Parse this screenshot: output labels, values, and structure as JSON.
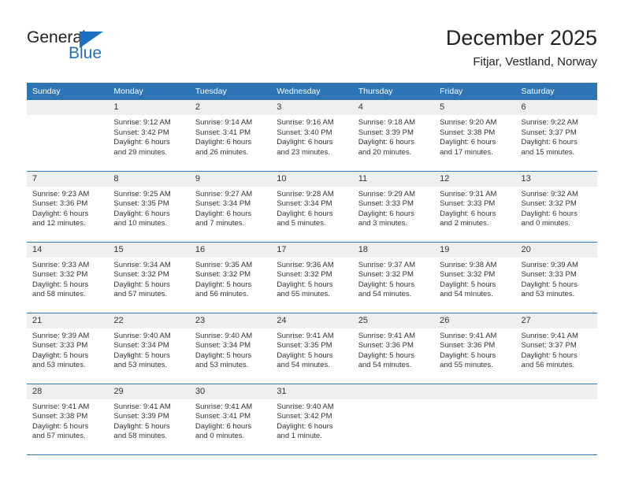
{
  "brand": {
    "word_one": "General",
    "word_two": "Blue",
    "accent_color": "#1f6fc0"
  },
  "header": {
    "title": "December 2025",
    "subtitle": "Fitjar, Vestland, Norway"
  },
  "theme": {
    "header_blue": "#2e75b6",
    "daynum_band": "#efefef",
    "text": "#333333"
  },
  "weekday_headers": [
    "Sunday",
    "Monday",
    "Tuesday",
    "Wednesday",
    "Thursday",
    "Friday",
    "Saturday"
  ],
  "weeks": [
    [
      {
        "day": ""
      },
      {
        "day": "1",
        "sunrise": "Sunrise: 9:12 AM",
        "sunset": "Sunset: 3:42 PM",
        "daylight_1": "Daylight: 6 hours",
        "daylight_2": "and 29 minutes."
      },
      {
        "day": "2",
        "sunrise": "Sunrise: 9:14 AM",
        "sunset": "Sunset: 3:41 PM",
        "daylight_1": "Daylight: 6 hours",
        "daylight_2": "and 26 minutes."
      },
      {
        "day": "3",
        "sunrise": "Sunrise: 9:16 AM",
        "sunset": "Sunset: 3:40 PM",
        "daylight_1": "Daylight: 6 hours",
        "daylight_2": "and 23 minutes."
      },
      {
        "day": "4",
        "sunrise": "Sunrise: 9:18 AM",
        "sunset": "Sunset: 3:39 PM",
        "daylight_1": "Daylight: 6 hours",
        "daylight_2": "and 20 minutes."
      },
      {
        "day": "5",
        "sunrise": "Sunrise: 9:20 AM",
        "sunset": "Sunset: 3:38 PM",
        "daylight_1": "Daylight: 6 hours",
        "daylight_2": "and 17 minutes."
      },
      {
        "day": "6",
        "sunrise": "Sunrise: 9:22 AM",
        "sunset": "Sunset: 3:37 PM",
        "daylight_1": "Daylight: 6 hours",
        "daylight_2": "and 15 minutes."
      }
    ],
    [
      {
        "day": "7",
        "sunrise": "Sunrise: 9:23 AM",
        "sunset": "Sunset: 3:36 PM",
        "daylight_1": "Daylight: 6 hours",
        "daylight_2": "and 12 minutes."
      },
      {
        "day": "8",
        "sunrise": "Sunrise: 9:25 AM",
        "sunset": "Sunset: 3:35 PM",
        "daylight_1": "Daylight: 6 hours",
        "daylight_2": "and 10 minutes."
      },
      {
        "day": "9",
        "sunrise": "Sunrise: 9:27 AM",
        "sunset": "Sunset: 3:34 PM",
        "daylight_1": "Daylight: 6 hours",
        "daylight_2": "and 7 minutes."
      },
      {
        "day": "10",
        "sunrise": "Sunrise: 9:28 AM",
        "sunset": "Sunset: 3:34 PM",
        "daylight_1": "Daylight: 6 hours",
        "daylight_2": "and 5 minutes."
      },
      {
        "day": "11",
        "sunrise": "Sunrise: 9:29 AM",
        "sunset": "Sunset: 3:33 PM",
        "daylight_1": "Daylight: 6 hours",
        "daylight_2": "and 3 minutes."
      },
      {
        "day": "12",
        "sunrise": "Sunrise: 9:31 AM",
        "sunset": "Sunset: 3:33 PM",
        "daylight_1": "Daylight: 6 hours",
        "daylight_2": "and 2 minutes."
      },
      {
        "day": "13",
        "sunrise": "Sunrise: 9:32 AM",
        "sunset": "Sunset: 3:32 PM",
        "daylight_1": "Daylight: 6 hours",
        "daylight_2": "and 0 minutes."
      }
    ],
    [
      {
        "day": "14",
        "sunrise": "Sunrise: 9:33 AM",
        "sunset": "Sunset: 3:32 PM",
        "daylight_1": "Daylight: 5 hours",
        "daylight_2": "and 58 minutes."
      },
      {
        "day": "15",
        "sunrise": "Sunrise: 9:34 AM",
        "sunset": "Sunset: 3:32 PM",
        "daylight_1": "Daylight: 5 hours",
        "daylight_2": "and 57 minutes."
      },
      {
        "day": "16",
        "sunrise": "Sunrise: 9:35 AM",
        "sunset": "Sunset: 3:32 PM",
        "daylight_1": "Daylight: 5 hours",
        "daylight_2": "and 56 minutes."
      },
      {
        "day": "17",
        "sunrise": "Sunrise: 9:36 AM",
        "sunset": "Sunset: 3:32 PM",
        "daylight_1": "Daylight: 5 hours",
        "daylight_2": "and 55 minutes."
      },
      {
        "day": "18",
        "sunrise": "Sunrise: 9:37 AM",
        "sunset": "Sunset: 3:32 PM",
        "daylight_1": "Daylight: 5 hours",
        "daylight_2": "and 54 minutes."
      },
      {
        "day": "19",
        "sunrise": "Sunrise: 9:38 AM",
        "sunset": "Sunset: 3:32 PM",
        "daylight_1": "Daylight: 5 hours",
        "daylight_2": "and 54 minutes."
      },
      {
        "day": "20",
        "sunrise": "Sunrise: 9:39 AM",
        "sunset": "Sunset: 3:33 PM",
        "daylight_1": "Daylight: 5 hours",
        "daylight_2": "and 53 minutes."
      }
    ],
    [
      {
        "day": "21",
        "sunrise": "Sunrise: 9:39 AM",
        "sunset": "Sunset: 3:33 PM",
        "daylight_1": "Daylight: 5 hours",
        "daylight_2": "and 53 minutes."
      },
      {
        "day": "22",
        "sunrise": "Sunrise: 9:40 AM",
        "sunset": "Sunset: 3:34 PM",
        "daylight_1": "Daylight: 5 hours",
        "daylight_2": "and 53 minutes."
      },
      {
        "day": "23",
        "sunrise": "Sunrise: 9:40 AM",
        "sunset": "Sunset: 3:34 PM",
        "daylight_1": "Daylight: 5 hours",
        "daylight_2": "and 53 minutes."
      },
      {
        "day": "24",
        "sunrise": "Sunrise: 9:41 AM",
        "sunset": "Sunset: 3:35 PM",
        "daylight_1": "Daylight: 5 hours",
        "daylight_2": "and 54 minutes."
      },
      {
        "day": "25",
        "sunrise": "Sunrise: 9:41 AM",
        "sunset": "Sunset: 3:36 PM",
        "daylight_1": "Daylight: 5 hours",
        "daylight_2": "and 54 minutes."
      },
      {
        "day": "26",
        "sunrise": "Sunrise: 9:41 AM",
        "sunset": "Sunset: 3:36 PM",
        "daylight_1": "Daylight: 5 hours",
        "daylight_2": "and 55 minutes."
      },
      {
        "day": "27",
        "sunrise": "Sunrise: 9:41 AM",
        "sunset": "Sunset: 3:37 PM",
        "daylight_1": "Daylight: 5 hours",
        "daylight_2": "and 56 minutes."
      }
    ],
    [
      {
        "day": "28",
        "sunrise": "Sunrise: 9:41 AM",
        "sunset": "Sunset: 3:38 PM",
        "daylight_1": "Daylight: 5 hours",
        "daylight_2": "and 57 minutes."
      },
      {
        "day": "29",
        "sunrise": "Sunrise: 9:41 AM",
        "sunset": "Sunset: 3:39 PM",
        "daylight_1": "Daylight: 5 hours",
        "daylight_2": "and 58 minutes."
      },
      {
        "day": "30",
        "sunrise": "Sunrise: 9:41 AM",
        "sunset": "Sunset: 3:41 PM",
        "daylight_1": "Daylight: 6 hours",
        "daylight_2": "and 0 minutes."
      },
      {
        "day": "31",
        "sunrise": "Sunrise: 9:40 AM",
        "sunset": "Sunset: 3:42 PM",
        "daylight_1": "Daylight: 6 hours",
        "daylight_2": "and 1 minute."
      },
      {
        "day": ""
      },
      {
        "day": ""
      },
      {
        "day": ""
      }
    ]
  ]
}
